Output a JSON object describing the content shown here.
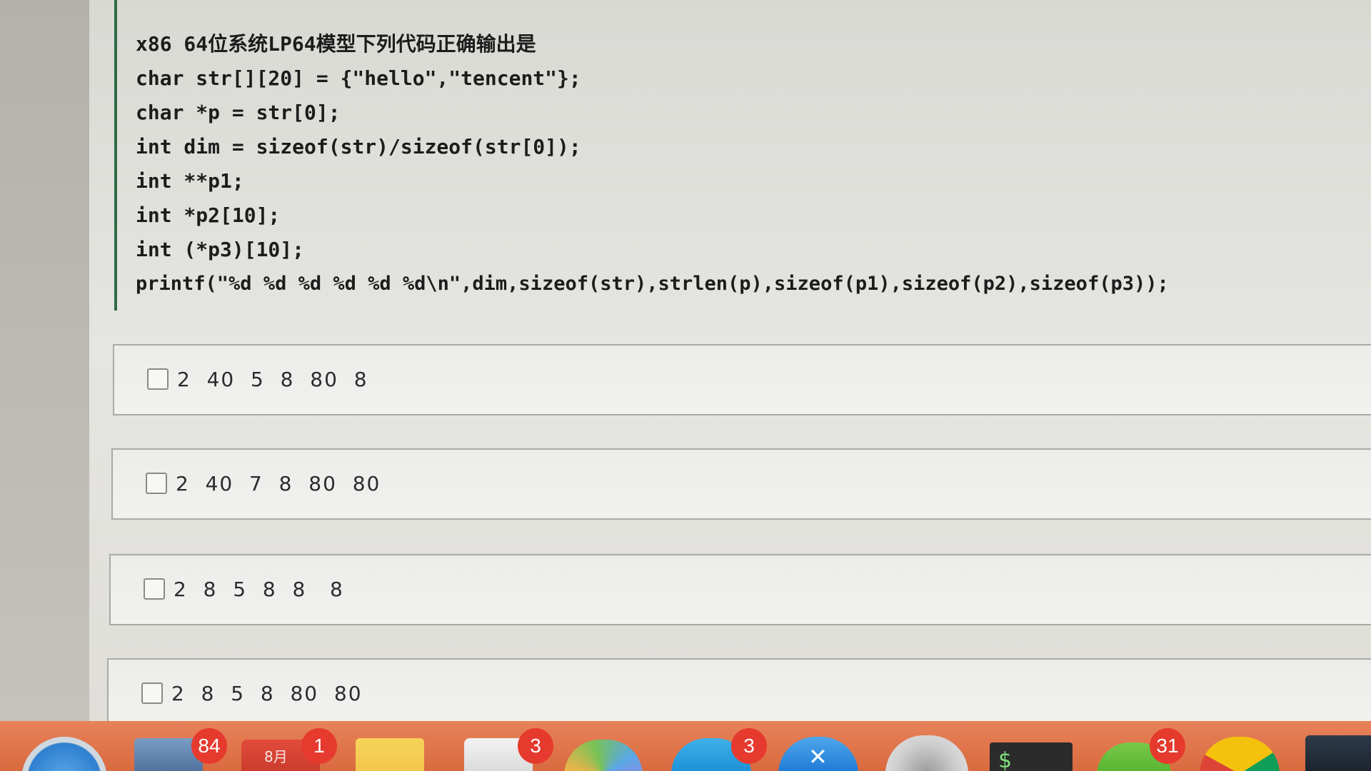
{
  "question": {
    "title": "x86 64位系统LP64模型下列代码正确输出是",
    "code_lines": [
      "char str[][20] = {\"hello\",\"tencent\"};",
      "char *p = str[0];",
      "int dim = sizeof(str)/sizeof(str[0]);",
      "int **p1;",
      "int *p2[10];",
      "int (*p3)[10];",
      "printf(\"%d %d %d %d %d %d\\n\",dim,sizeof(str),strlen(p),sizeof(p1),sizeof(p2),sizeof(p3));"
    ]
  },
  "options": [
    {
      "label": "2  40  5  8  80  8",
      "checked": false
    },
    {
      "label": "2  40  7  8  80  80",
      "checked": false
    },
    {
      "label": "2  8  5  8  8   8",
      "checked": false
    },
    {
      "label": "2  8  5  8  80  80",
      "checked": false
    }
  ],
  "dock": {
    "badges": {
      "mail": "84",
      "calendar": "1",
      "reminders": "3",
      "qq": "3",
      "wechat": "31"
    },
    "calendar_month": "8月",
    "terminal_prompt": "$",
    "colors": {
      "dock_bg": "#d96a3e",
      "badge": "#e63a2e",
      "accent_border": "#2e6b45"
    }
  }
}
